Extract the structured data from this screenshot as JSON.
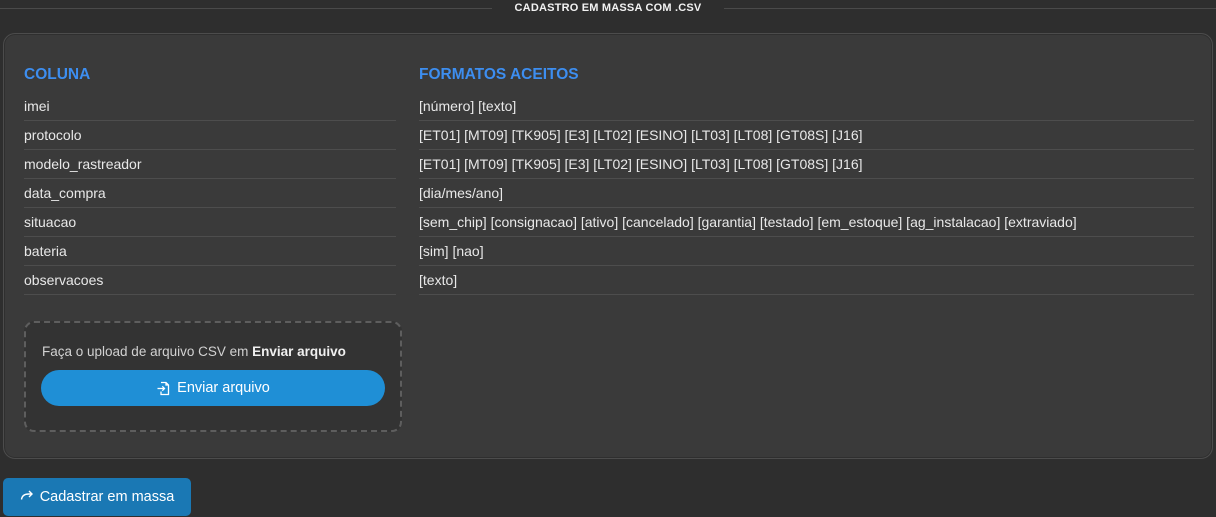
{
  "header": {
    "title": "CADASTRO EM MASSA COM .CSV"
  },
  "table": {
    "headers": {
      "column": "COLUNA",
      "formats": "FORMATOS ACEITOS"
    },
    "rows": [
      {
        "column": "imei",
        "formats": "[número] [texto]"
      },
      {
        "column": "protocolo",
        "formats": "[ET01] [MT09] [TK905] [E3] [LT02] [ESINO] [LT03] [LT08] [GT08S] [J16]"
      },
      {
        "column": "modelo_rastreador",
        "formats": "[ET01] [MT09] [TK905] [E3] [LT02] [ESINO] [LT03] [LT08] [GT08S] [J16]"
      },
      {
        "column": "data_compra",
        "formats": "[dia/mes/ano]"
      },
      {
        "column": "situacao",
        "formats": "[sem_chip] [consignacao] [ativo] [cancelado] [garantia] [testado] [em_estoque] [ag_instalacao] [extraviado]"
      },
      {
        "column": "bateria",
        "formats": "[sim] [nao]"
      },
      {
        "column": "observacoes",
        "formats": "[texto]"
      }
    ]
  },
  "upload": {
    "hint_prefix": "Faça o upload de arquivo CSV em",
    "hint_bold": "Enviar arquivo",
    "button_label": "Enviar arquivo",
    "button_icon": "file-import-icon"
  },
  "actions": {
    "mass_register_label": "Cadastrar em massa",
    "mass_register_icon": "share-arrow-icon"
  },
  "colors": {
    "accent": "#3d8ef0",
    "upload_button": "#1f8fd6",
    "mass_button": "#1a78b4",
    "panel_bg": "#3a3a3a",
    "page_bg": "#2e2e2e"
  }
}
